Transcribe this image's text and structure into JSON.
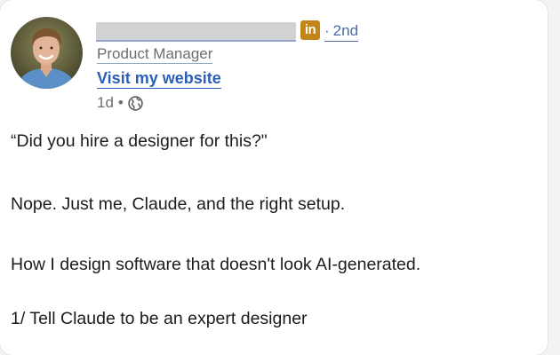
{
  "post": {
    "author": {
      "badge": "in",
      "connection_degree": "2nd",
      "headline": "Product Manager",
      "website_link": "Visit my website"
    },
    "time_ago": "1d",
    "visibility_icon": "globe-icon",
    "paragraphs": [
      "“Did you hire a designer for this?\"",
      "Nope. Just me, Claude, and the right setup.",
      "How I design software that doesn't look AI-generated.",
      "1/ Tell Claude to be an expert designer"
    ]
  },
  "colors": {
    "link": "#2b5fb8",
    "degree": "#4a6aa8",
    "linkedin_badge": "#c2851a",
    "redacted_name": "#d2d2d4",
    "muted_text": "#6d6d6d",
    "body_text": "#1c1c1c"
  }
}
